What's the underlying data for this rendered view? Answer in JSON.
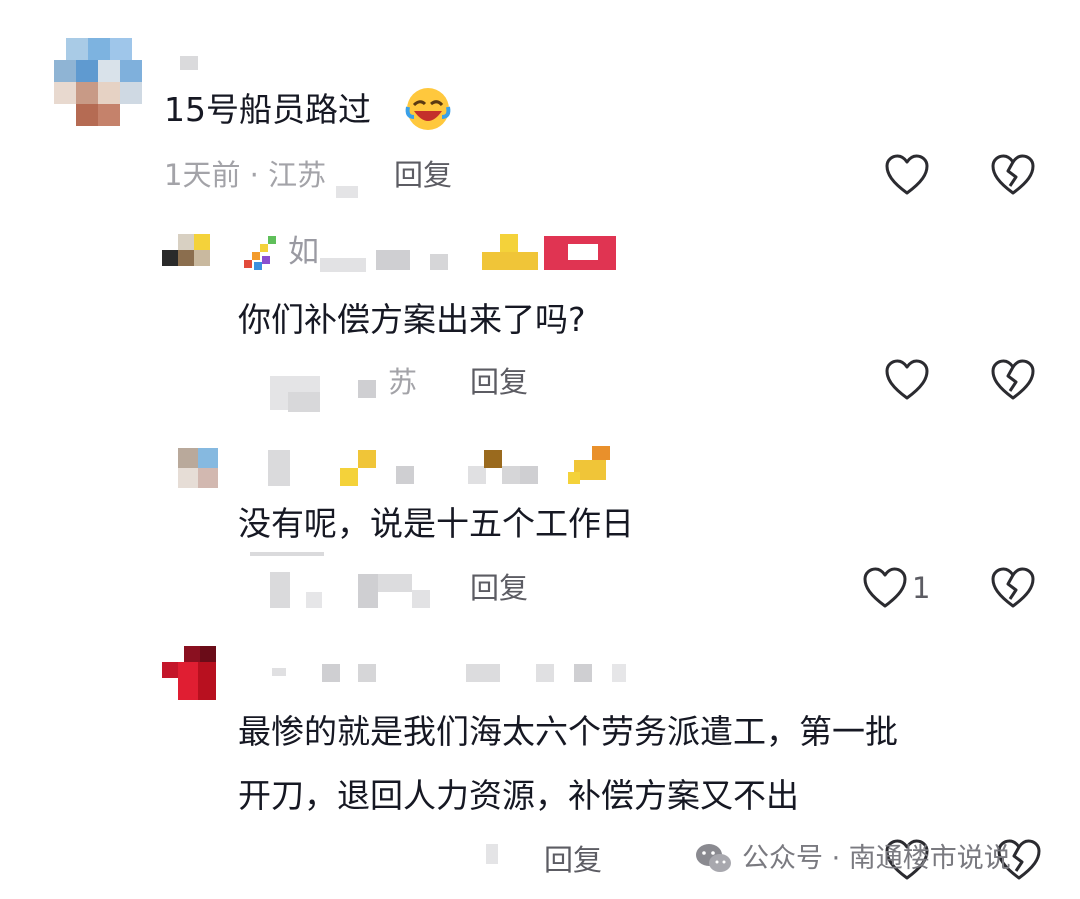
{
  "comments": [
    {
      "text": "15号船员路过",
      "meta": "1天前 · 江苏",
      "reply_label": "回复"
    },
    {
      "name_fragment": "如",
      "text": "你们补偿方案出来了吗?",
      "meta_fragment": "苏",
      "reply_label": "回复"
    },
    {
      "text": "没有呢，说是十五个工作日",
      "reply_label": "回复",
      "like_count": "1"
    },
    {
      "text_line1": "最惨的就是我们海太六个劳务派遣工，第一批",
      "text_line2": "开刀，退回人力资源，补偿方案又不出",
      "reply_label": "回复"
    }
  ],
  "watermark": {
    "icon": "wechat-icon",
    "text": "公众号 · 南通楼市说说"
  },
  "colors": {
    "text": "#161823",
    "meta": "#a3a3a8",
    "reply": "#5c5c63",
    "icon_stroke": "#2b2b30"
  }
}
